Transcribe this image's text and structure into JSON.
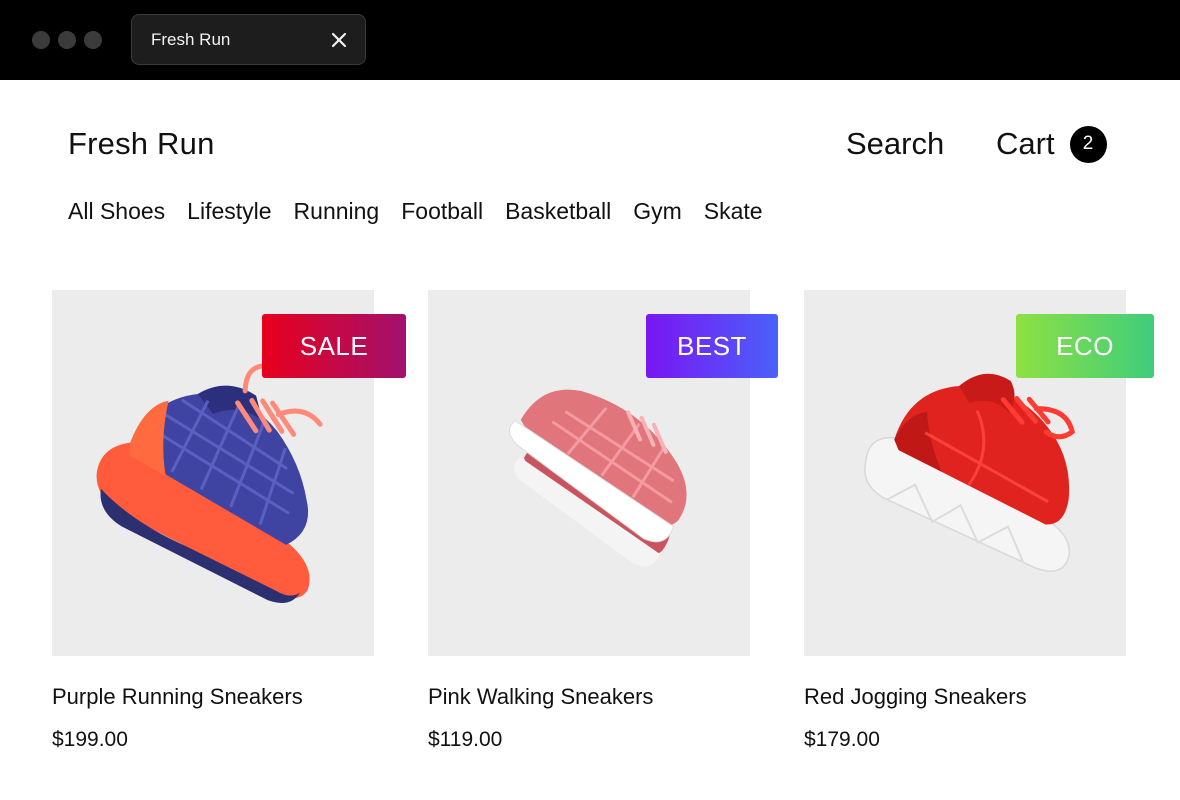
{
  "browser": {
    "tab_title": "Fresh Run"
  },
  "header": {
    "logo": "Fresh Run",
    "search_label": "Search",
    "cart_label": "Cart",
    "cart_count": "2"
  },
  "nav": {
    "items": [
      "All Shoes",
      "Lifestyle",
      "Running",
      "Football",
      "Basketball",
      "Gym",
      "Skate"
    ]
  },
  "products": [
    {
      "name": "Purple Running Sneakers",
      "price": "$199.00",
      "badge": "SALE"
    },
    {
      "name": "Pink Walking Sneakers",
      "price": "$119.00",
      "badge": "BEST"
    },
    {
      "name": "Red Jogging Sneakers",
      "price": "$179.00",
      "badge": "ECO"
    }
  ],
  "colors": {
    "badge_sale": "#e8001c",
    "badge_best": "#7a16f2",
    "badge_eco": "#8ee042",
    "card_bg": "#ececec"
  }
}
